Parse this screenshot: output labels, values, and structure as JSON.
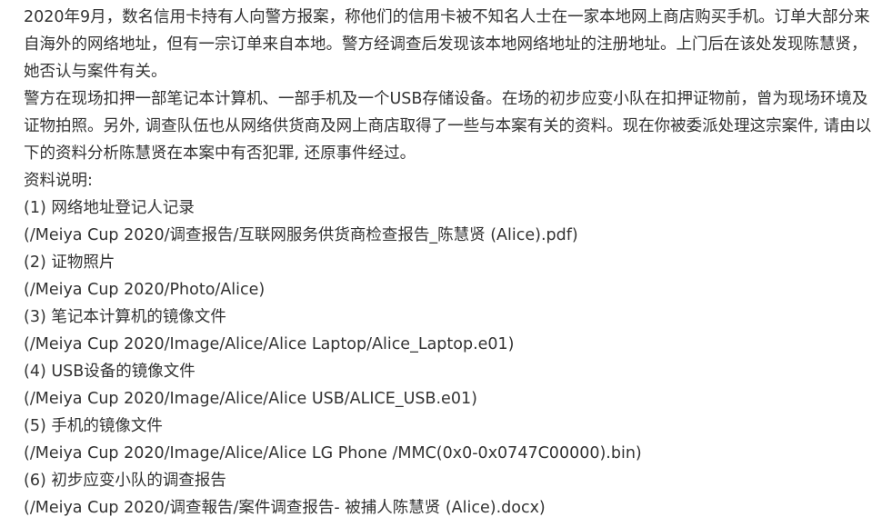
{
  "article": {
    "paragraph_1": "2020年9月，数名信用卡持有人向警方报案，称他们的信用卡被不知名人士在一家本地网上商店购买手机。订单大部分来自海外的网络地址，但有一宗订单来自本地。警方经调查后发现该本地网络地址的注册地址。上门后在该处发现陈慧贤，她否认与案件有关。",
    "paragraph_2": "警方在现场扣押一部笔记本计算机、一部手机及一个USB存储设备。在场的初步应变小队在扣押证物前，曾为现场环境及证物拍照。另外, 调查队伍也从网络供货商及网上商店取得了一些与本案有关的资料。现在你被委派处理这宗案件, 请由以下的资料分析陈慧贤在本案中有否犯罪, 还原事件经过。",
    "materials_heading": "资料说明:",
    "items": [
      {
        "label": "(1) 网络地址登记人记录",
        "path": "(/Meiya Cup 2020/调查报告/互联网服务供货商检查报告_陈慧贤 (Alice).pdf)"
      },
      {
        "label": "(2) 证物照片",
        "path": "(/Meiya Cup 2020/Photo/Alice)"
      },
      {
        "label": "(3) 笔记本计算机的镜像文件",
        "path": "(/Meiya Cup 2020/Image/Alice/Alice Laptop/Alice_Laptop.e01)"
      },
      {
        "label": "(4) USB设备的镜像文件",
        "path": "(/Meiya Cup 2020/Image/Alice/Alice USB/ALICE_USB.e01)"
      },
      {
        "label": "(5) 手机的镜像文件",
        "path": "(/Meiya Cup 2020/Image/Alice/Alice LG Phone /MMC(0x0-0x0747C00000).bin)"
      },
      {
        "label": "(6) 初步应变小队的调查报告",
        "path": "(/Meiya Cup 2020/调查報告/案件调查报告- 被捕人陈慧贤 (Alice).docx)"
      }
    ]
  }
}
